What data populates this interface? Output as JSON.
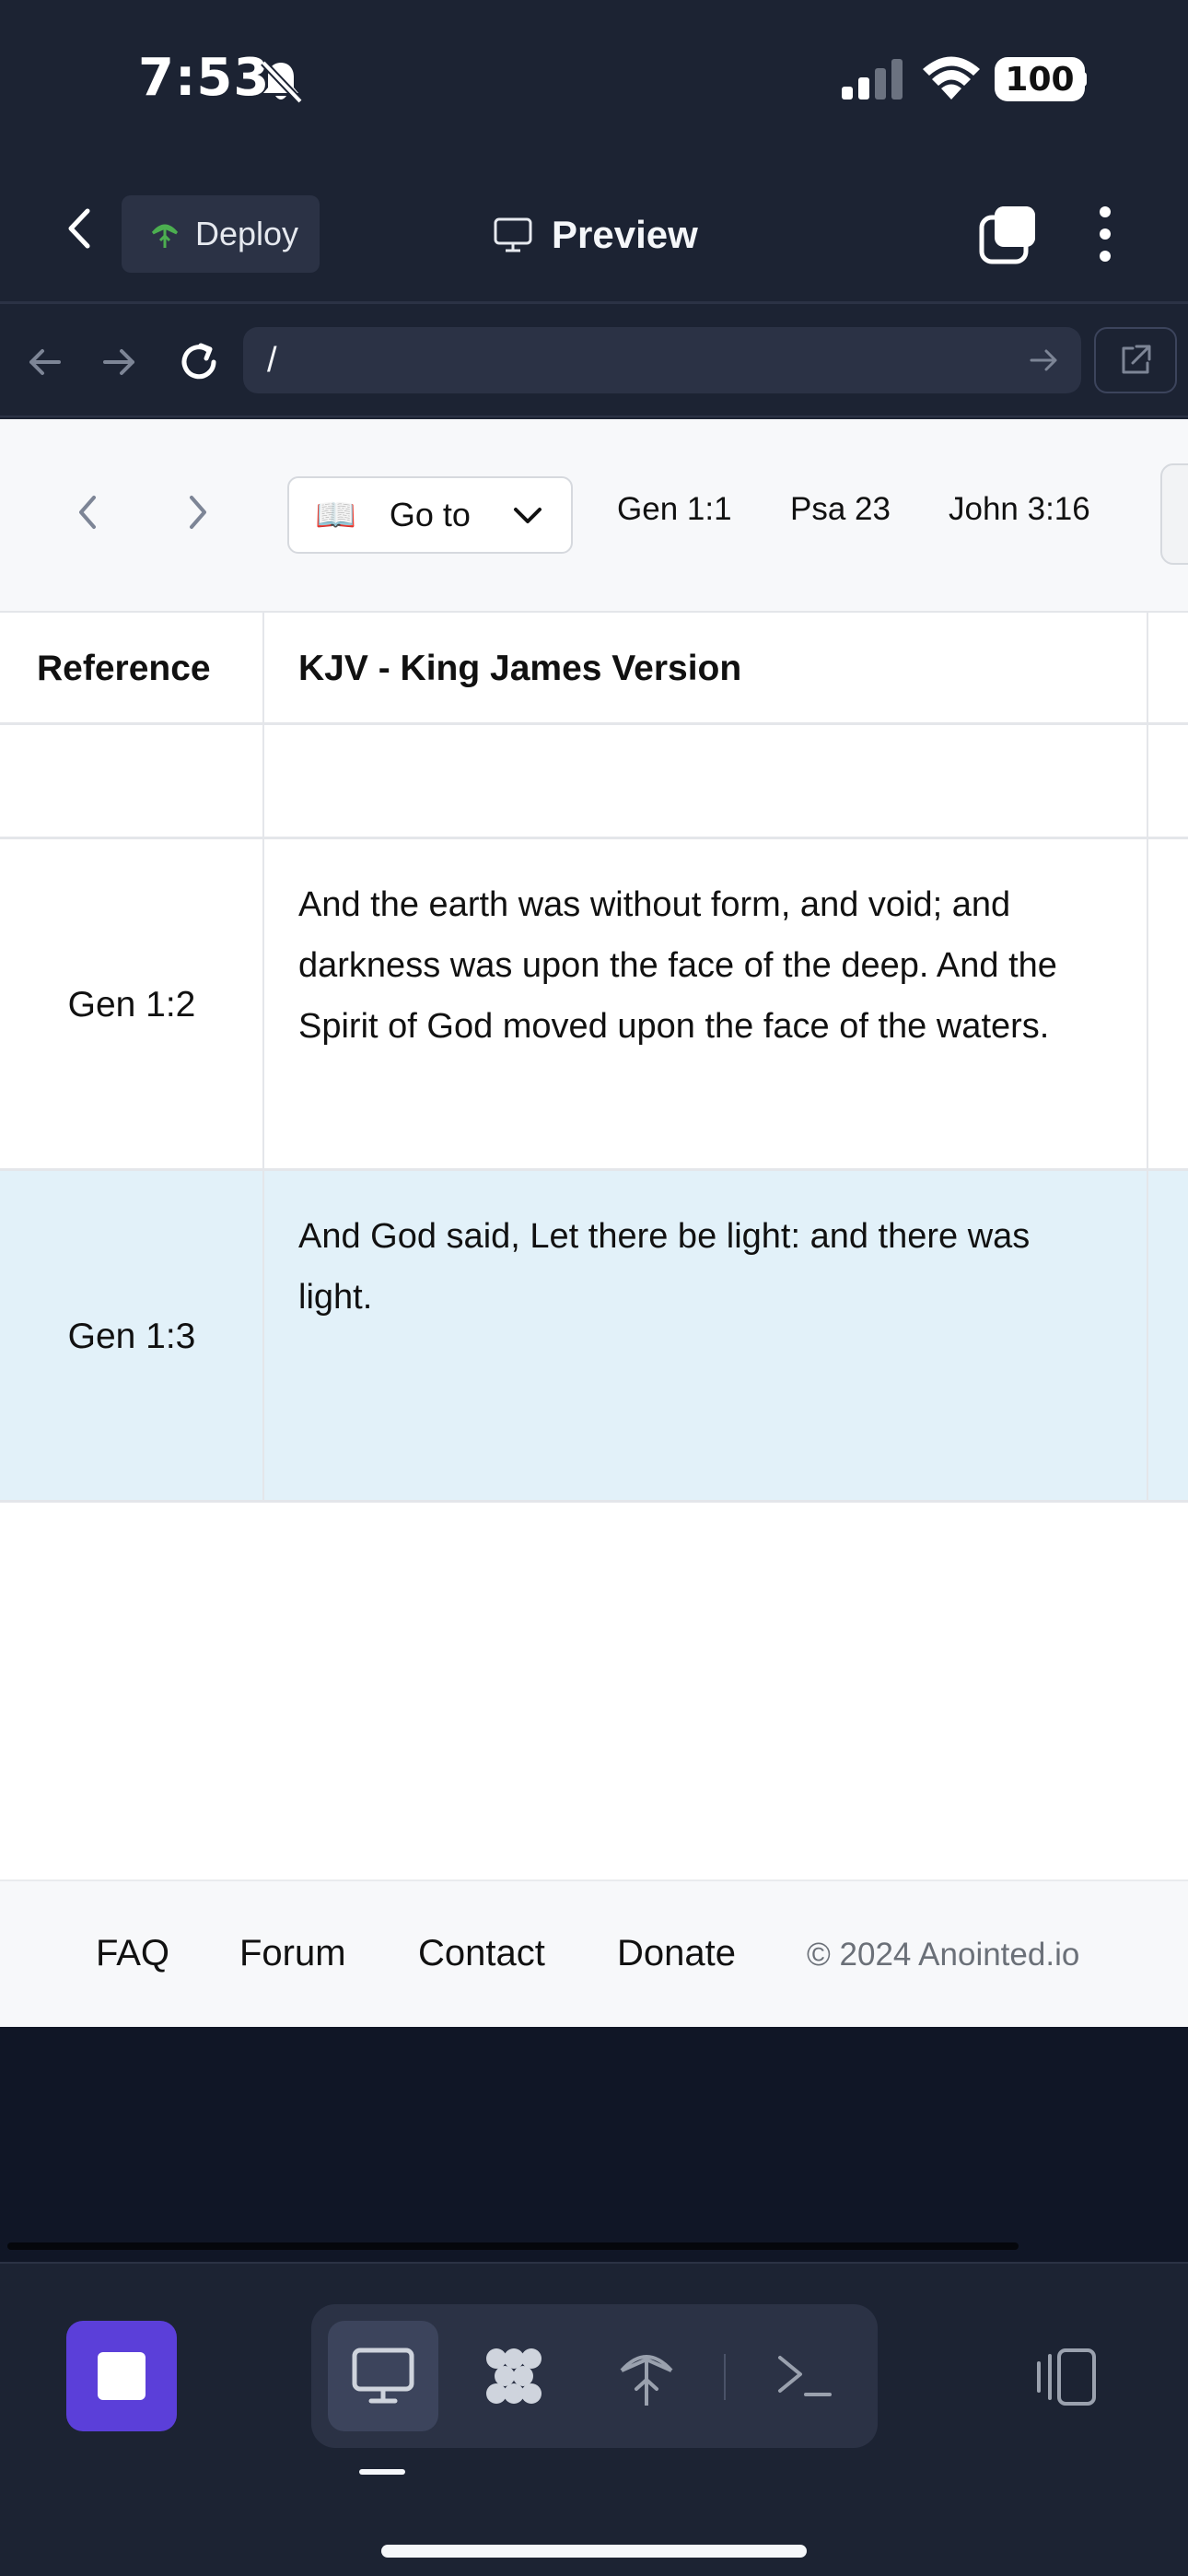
{
  "status_bar": {
    "time": "7:53",
    "battery": "100",
    "icons": [
      "bell-muted-icon",
      "signal-icon",
      "wifi-icon"
    ]
  },
  "header": {
    "deploy_label": "Deploy",
    "preview_label": "Preview",
    "deploy_icon_color": "#4caf50"
  },
  "address_bar": {
    "url": "/"
  },
  "toolbar": {
    "goto_icon": "📖",
    "goto_label": "Go to",
    "quick_links": [
      "Gen 1:1",
      "Psa 23",
      "John 3:16"
    ]
  },
  "table": {
    "headers": [
      "Reference",
      "KJV - King James Version"
    ],
    "rows": [
      {
        "reference": "",
        "text": ""
      },
      {
        "reference": "Gen 1:2",
        "text": "And the earth was without form, and void; and darkness was upon the face of the deep. And the Spirit of God moved upon the face of the waters."
      },
      {
        "reference": "Gen 1:3",
        "text": "And God said, Let there be light: and there was light."
      }
    ]
  },
  "footer": {
    "links": [
      "FAQ",
      "Forum",
      "Contact",
      "Donate"
    ],
    "copyright": "© 2024 Anointed.io"
  },
  "colors": {
    "chrome_bg": "#1c2333",
    "accent": "#5b3fd9",
    "highlight_row": "#e2f1f9"
  }
}
